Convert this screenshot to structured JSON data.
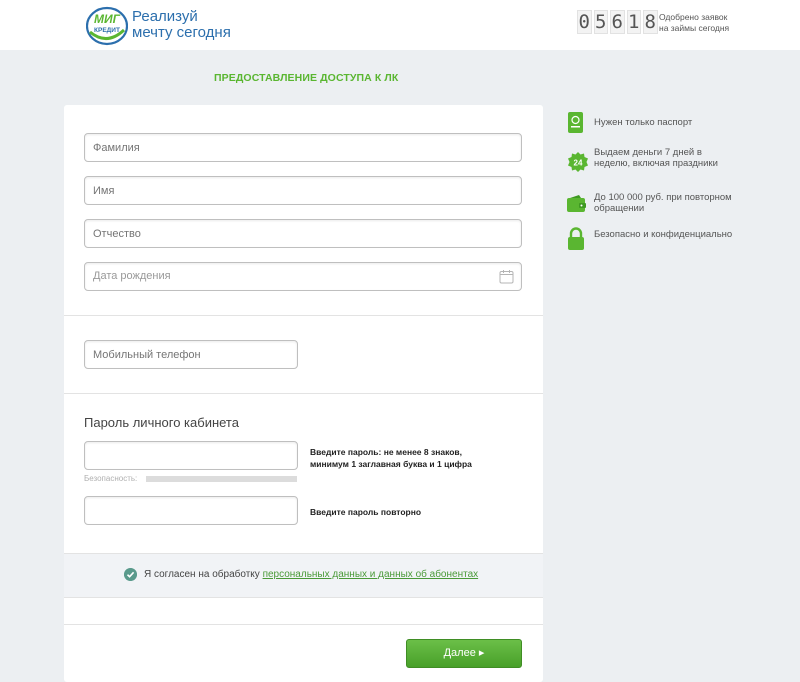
{
  "header": {
    "logo_line1": "МИГ",
    "logo_line2": "КРЕДИТ",
    "tagline_line1": "Реализуй",
    "tagline_line2": "мечту сегодня",
    "counter_digits": [
      "0",
      "5",
      "6",
      "1",
      "8"
    ],
    "counter_text_line1": "Одобрено заявок",
    "counter_text_line2": "на займы сегодня"
  },
  "page": {
    "title": "ПРЕДОСТАВЛЕНИЕ ДОСТУПА К ЛК"
  },
  "form": {
    "lastname_placeholder": "Фамилия",
    "firstname_placeholder": "Имя",
    "middlename_placeholder": "Отчество",
    "birthdate_placeholder": "Дата рождения",
    "phone_placeholder": "Мобильный телефон",
    "password_section_title": "Пароль личного кабинета",
    "password_hint_line1": "Введите пароль: не менее 8 знаков,",
    "password_hint_line2": "минимум 1 заглавная буква и 1 цифра",
    "strength_label": "Безопасность:",
    "repeat_hint": "Введите пароль повторно",
    "agree_text": "Я согласен на обработку",
    "agree_link": "персональных данных и данных об абонентах",
    "submit_label": "Далее ▸"
  },
  "features": [
    {
      "icon": "passport-icon",
      "text": "Нужен только паспорт"
    },
    {
      "icon": "24-hours-icon",
      "text": "Выдаем деньги 7 дней в неделю, включая праздники"
    },
    {
      "icon": "wallet-icon",
      "text": "До 100 000 руб. при повторном обращении"
    },
    {
      "icon": "lock-icon",
      "text": "Безопасно и конфиденциально"
    }
  ],
  "colors": {
    "accent_green": "#5ab631",
    "brand_blue": "#2c6fad",
    "background": "#eceff2"
  }
}
